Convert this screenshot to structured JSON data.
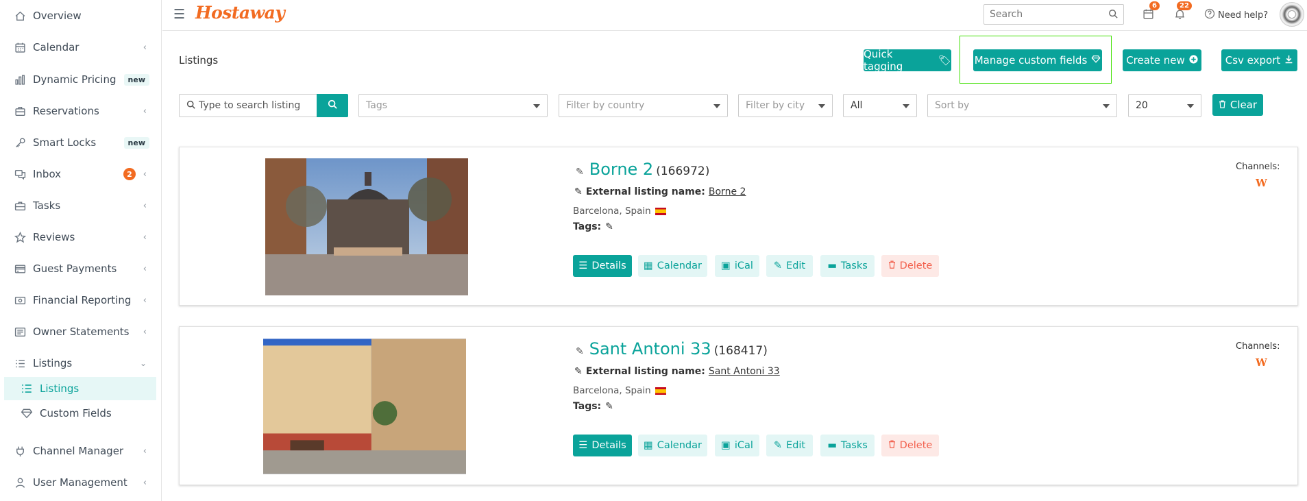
{
  "sidebar": {
    "items": [
      {
        "label": "Overview",
        "icon": "home-icon",
        "chevron": false
      },
      {
        "label": "Calendar",
        "icon": "calendar-icon",
        "chevron": true
      },
      {
        "label": "Dynamic Pricing",
        "icon": "bar-chart-icon",
        "badge": "new"
      },
      {
        "label": "Reservations",
        "icon": "briefcase-icon",
        "chevron": true
      },
      {
        "label": "Smart Locks",
        "icon": "key-icon",
        "badge": "new"
      },
      {
        "label": "Inbox",
        "icon": "chat-icon",
        "count": "2",
        "chevron": true
      },
      {
        "label": "Tasks",
        "icon": "toolbox-icon",
        "chevron": true
      },
      {
        "label": "Reviews",
        "icon": "star-icon",
        "chevron": true
      },
      {
        "label": "Guest Payments",
        "icon": "credit-card-icon",
        "chevron": true
      },
      {
        "label": "Financial Reporting",
        "icon": "money-icon",
        "chevron": true
      },
      {
        "label": "Owner Statements",
        "icon": "statement-icon",
        "chevron": true
      },
      {
        "label": "Listings",
        "icon": "list-icon",
        "expanded": true
      },
      {
        "label": "Channel Manager",
        "icon": "plug-icon",
        "chevron": true
      },
      {
        "label": "User Management",
        "icon": "user-icon",
        "chevron": true
      }
    ],
    "sub_items": [
      {
        "label": "Listings",
        "icon": "list-icon",
        "active": true
      },
      {
        "label": "Custom Fields",
        "icon": "diamond-icon",
        "active": false
      }
    ]
  },
  "header": {
    "logo": "Hostaway",
    "search_placeholder": "Search",
    "calendar_badge": "6",
    "bell_badge": "22",
    "help_label": "Need help?"
  },
  "main": {
    "title": "Listings",
    "buttons": {
      "quick_tagging": "Quick tagging",
      "manage_custom_fields": "Manage custom fields",
      "create_new": "Create new",
      "csv_export": "Csv export"
    },
    "filters": {
      "search_placeholder": "Type to search listing",
      "tags": "Tags",
      "country": "Filter by country",
      "city": "Filter by city",
      "status": "All",
      "sort": "Sort by",
      "per_page": "20",
      "clear": "Clear"
    }
  },
  "listings": [
    {
      "name": "Borne 2",
      "id": "(166972)",
      "ext_label": "External listing name:",
      "ext_name": "Borne 2",
      "location": "Barcelona, Spain",
      "tags_label": "Tags:",
      "channels_label": "Channels:",
      "channel_icon": "W"
    },
    {
      "name": "Sant Antoni 33",
      "id": "(168417)",
      "ext_label": "External listing name:",
      "ext_name": "Sant Antoni 33",
      "location": "Barcelona, Spain",
      "tags_label": "Tags:",
      "channels_label": "Channels:",
      "channel_icon": "W"
    }
  ],
  "actions": {
    "details": "Details",
    "calendar": "Calendar",
    "ical": "iCal",
    "edit": "Edit",
    "tasks": "Tasks",
    "delete": "Delete"
  },
  "colors": {
    "accent": "#0aa39a",
    "brand": "#f26b21",
    "danger": "#f25f4c"
  }
}
